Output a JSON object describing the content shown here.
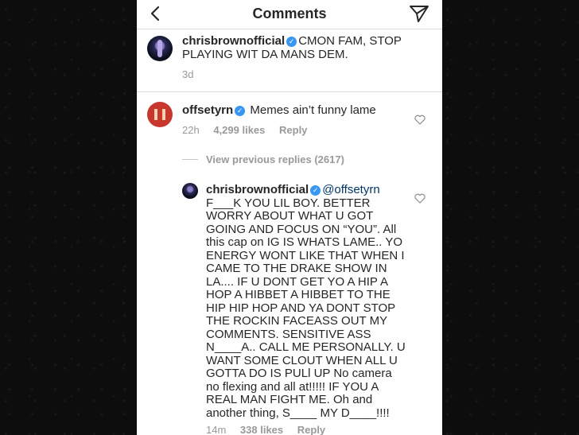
{
  "header": {
    "title": "Comments"
  },
  "caption": {
    "username": "chrisbrownofficial",
    "text": "CMON FAM, STOP PLAYING WIT DA MANS DEM.",
    "time": "3d"
  },
  "comment": {
    "username": "offsetyrn",
    "text": "Memes ain’t funny lame",
    "time": "22h",
    "likes": "4,299 likes",
    "reply_label": "Reply"
  },
  "view_replies": "View previous replies (2617)",
  "reply": {
    "username": "chrisbrownofficial",
    "mention": "@offsetyrn",
    "lines": [
      "F___K YOU LIL BOY. BETTER",
      "WORRY ABOUT WHAT U GOT",
      "GOING AND FOCUS ON “YOU”. All",
      "this cap on IG IS WHATS LAME.. YO",
      "ENERGY WONT LIKE THAT WHEN I",
      "CAME TO THE DRAKE SHOW IN",
      "LA.... IF U DONT  GET YO A HIP A",
      "HOP A HIBBET A HIBBET TO THE",
      "HIP HIP HOP AND YA DONT STOP",
      "THE ROCKIN  FACEASS OUT MY",
      "COMMENTS. SENSITIVE ASS",
      "N____A.. CALL ME PERSONALLY. U",
      "WANT SOME CLOUT WHEN ALL U",
      "GOTTA DO IS PULl UP No camera",
      "no flexing and all at!!!!! IF YOU A",
      "REAL MAN FIGHT ME. Oh and",
      "another thing,  S____ MY D____!!!!"
    ],
    "time": "14m",
    "likes": "338 likes",
    "reply_label": "Reply"
  },
  "colors": {
    "verified": "#3897f0",
    "meta": "#999999",
    "divider": "#dbdbdb"
  },
  "icons": [
    "chevron-left-icon",
    "send-icon",
    "verified-icon",
    "heart-icon"
  ]
}
